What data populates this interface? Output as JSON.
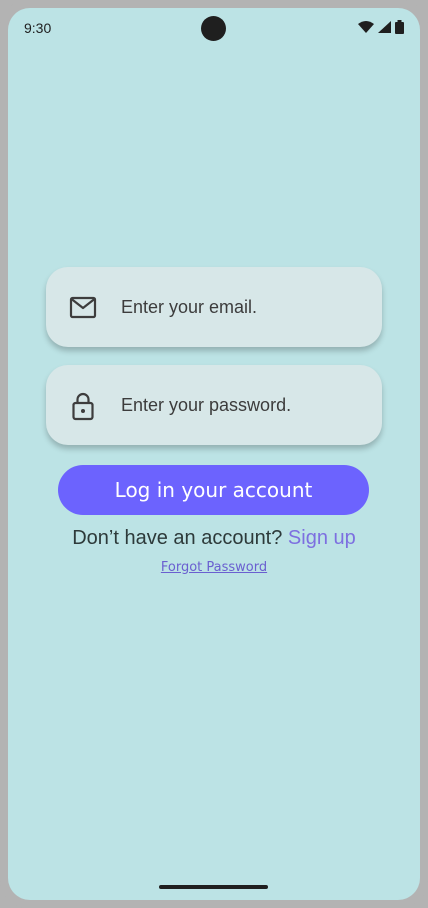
{
  "status_bar": {
    "time": "9:30"
  },
  "login": {
    "email_placeholder": "Enter your email.",
    "password_placeholder": "Enter your password.",
    "email_icon": "mail-icon",
    "password_icon": "lock-icon",
    "login_button_label": "Log in your account",
    "signup_prompt": "Don’t have an account?",
    "signup_link": "Sign up",
    "forgot_password": "Forgot Password"
  },
  "colors": {
    "background": "#bce3e5",
    "field_background": "#d7e7e8",
    "primary_button": "#6c63fe",
    "link": "#7d6fe0"
  }
}
